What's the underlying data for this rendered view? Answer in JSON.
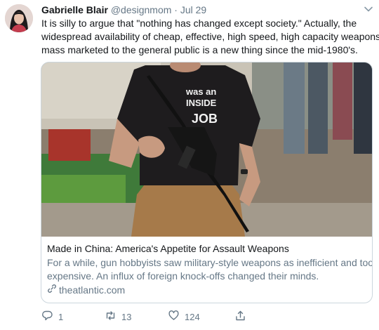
{
  "author": {
    "name": "Gabrielle Blair",
    "handle": "@designmom",
    "separator": "·",
    "date": "Jul 29"
  },
  "tweet": {
    "lines": [
      "It is silly to argue that \"nothing has changed except society.\" Actually, the",
      "widespread availability of cheap, effective, high speed, high capacity weapons",
      "mass marketed to the general public is a new thing since the mid-1980's."
    ]
  },
  "card": {
    "image_shirt_text": [
      "was an",
      "INSIDE",
      "JOB"
    ],
    "title": "Made in China: America's Appetite for Assault Weapons",
    "description_lines": [
      "For a while, gun hobbyists saw military-style weapons as inefficient and too",
      "expensive. An influx of foreign knock-offs changed their minds."
    ],
    "domain": "theatlantic.com"
  },
  "actions": {
    "reply_count": "1",
    "retweet_count": "13",
    "like_count": "124"
  },
  "colors": {
    "text": "#14171a",
    "muted": "#657786",
    "border": "#ccd6dd"
  },
  "icons": [
    "chevron-down-icon",
    "link-icon",
    "reply-icon",
    "retweet-icon",
    "like-icon",
    "share-icon"
  ]
}
